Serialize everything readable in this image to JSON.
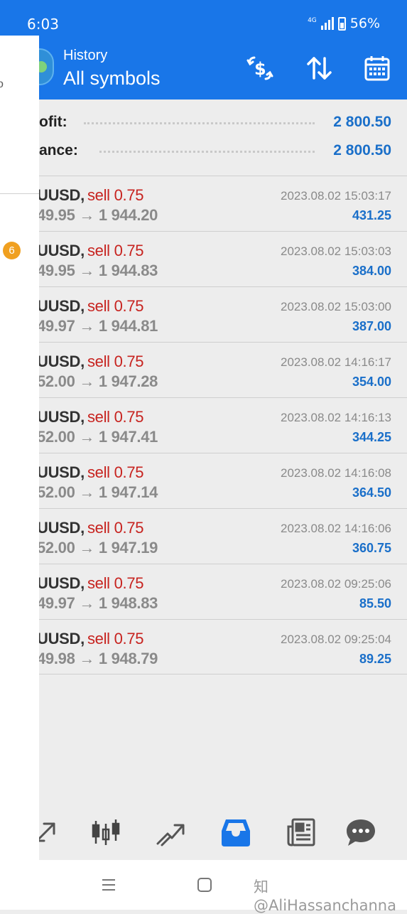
{
  "status": {
    "time": "6:03",
    "network": "4G",
    "battery": "56%"
  },
  "header": {
    "title": "History",
    "subtitle": "All symbols"
  },
  "drawer": {
    "badge": "6",
    "fragment": "o"
  },
  "summary": {
    "profit_label": "ofit:",
    "profit_value": "2 800.50",
    "balance_label": "ance:",
    "balance_value": "2 800.50"
  },
  "trades": [
    {
      "symbol": "UUSD,",
      "side": "sell 0.75",
      "prices": "49.95 → 1 944.20",
      "time": "2023.08.02 15:03:17",
      "profit": "431.25"
    },
    {
      "symbol": "UUSD,",
      "side": "sell 0.75",
      "prices": "49.95 → 1 944.83",
      "time": "2023.08.02 15:03:03",
      "profit": "384.00"
    },
    {
      "symbol": "UUSD,",
      "side": "sell 0.75",
      "prices": "49.97 → 1 944.81",
      "time": "2023.08.02 15:03:00",
      "profit": "387.00"
    },
    {
      "symbol": "UUSD,",
      "side": "sell 0.75",
      "prices": "52.00 → 1 947.28",
      "time": "2023.08.02 14:16:17",
      "profit": "354.00"
    },
    {
      "symbol": "UUSD,",
      "side": "sell 0.75",
      "prices": "52.00 → 1 947.41",
      "time": "2023.08.02 14:16:13",
      "profit": "344.25"
    },
    {
      "symbol": "UUSD,",
      "side": "sell 0.75",
      "prices": "52.00 → 1 947.14",
      "time": "2023.08.02 14:16:08",
      "profit": "364.50"
    },
    {
      "symbol": "UUSD,",
      "side": "sell 0.75",
      "prices": "52.00 → 1 947.19",
      "time": "2023.08.02 14:16:06",
      "profit": "360.75"
    },
    {
      "symbol": "UUSD,",
      "side": "sell 0.75",
      "prices": "49.97 → 1 948.83",
      "time": "2023.08.02 09:25:06",
      "profit": "85.50"
    },
    {
      "symbol": "UUSD,",
      "side": "sell 0.75",
      "prices": "49.98 → 1 948.79",
      "time": "2023.08.02 09:25:04",
      "profit": "89.25"
    }
  ],
  "bottom_nav": [
    "quotes-icon",
    "chart-candles-icon",
    "trade-icon",
    "history-inbox-icon",
    "news-icon",
    "chat-icon"
  ],
  "colors": {
    "primary": "#1976e8",
    "sell": "#c7231f",
    "profit": "#1a6fc9",
    "badge": "#f0a020"
  },
  "watermark": "知@AliHassanchanna"
}
